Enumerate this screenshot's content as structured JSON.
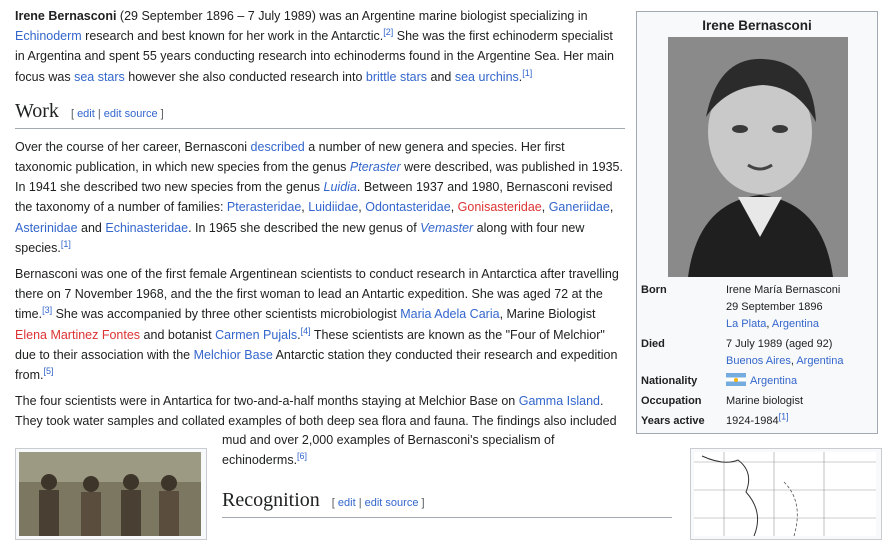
{
  "intro": {
    "name": "Irene Bernasconi",
    "t1": " (29 September 1896 – 7 July 1989) was an Argentine marine biologist specializing in ",
    "link_echinoderm": "Echinoderm",
    "t2": " research and best known for her work in the Antarctic.",
    "ref2": "[2]",
    "t3": " She was the first echinoderm specialist in Argentina and spent 55 years conducting research into echinoderms found in the Argentine Sea. Her main focus was ",
    "link_seastars": "sea stars",
    "t4": " however she also conducted research into ",
    "link_brittlestars": "brittle stars",
    "t5": " and ",
    "link_urchins": "sea urchins",
    "t6": ".",
    "ref1": "[1]"
  },
  "work": {
    "heading": "Work",
    "edit_open": "[",
    "edit": "edit",
    "sep": " | ",
    "edit_source": "edit source",
    "edit_close": "]",
    "p1": {
      "t1": "Over the course of her career, Bernasconi ",
      "link_described": "described",
      "t2": " a number of new genera and species. Her first taxonomic publication, in which new species from the genus ",
      "link_pteraster": "Pteraster",
      "t3": " were described, was published in 1935. In 1941 she described two new species from the genus ",
      "link_luidia": "Luidia",
      "t4": ". Between 1937 and 1980, Bernasconi revised the taxonomy of a number of families: ",
      "f1": "Pterasteridae",
      "c1": ", ",
      "f2": "Luidiidae",
      "c2": ", ",
      "f3": "Odontasteridae",
      "c3": ", ",
      "f4": "Gonisasteridae",
      "c4": ", ",
      "f5": "Ganeriidae",
      "c5": ", ",
      "f6": "Asterinidae",
      "and": " and ",
      "f7": "Echinasteridae",
      "t5": ". In 1965 she described the new genus of ",
      "link_vemaster": "Vemaster",
      "t6": " along with four new species.",
      "ref1": "[1]"
    },
    "p2": {
      "t1": "Bernasconi was one of the first female Argentinean scientists to conduct research in Antarctica after travelling there on 7 November 1968, and the the first woman to lead an Antartic expedition. She was aged 72 at the time.",
      "ref3": "[3]",
      "t2": " She was accompanied by three other scientists microbiologist ",
      "link_caria": "Maria Adela Caria",
      "t3": ", Marine Biologist ",
      "link_fontes": "Elena Martinez Fontes",
      "t4": " and botanist ",
      "link_pujals": "Carmen Pujals",
      "t5": ".",
      "ref4": "[4]",
      "t6": " These scientists are known as the \"Four of Melchior\" due to their association with the ",
      "link_melchior": "Melchior Base",
      "t7": " Antarctic station they conducted their research and expedition from.",
      "ref5": "[5]"
    },
    "p3": {
      "t1": "The four scientists were in Antartica for two-and-a-half months staying at Melchior Base on ",
      "link_gamma": "Gamma Island",
      "t2": ". They took water samples and collated examples of both deep sea flora and fauna. The findings also included",
      "t3": "mud and over 2,000 examples of Bernasconi's specialism of echinoderms.",
      "ref6": "[6]"
    }
  },
  "recognition": {
    "heading": "Recognition",
    "edit_open": "[",
    "edit": "edit",
    "sep": " | ",
    "edit_source": "edit source",
    "edit_close": "]"
  },
  "infobox": {
    "title": "Irene Bernasconi",
    "born_label": "Born",
    "born_name": "Irene María Bernasconi",
    "born_date": "29 September 1896",
    "born_place1": "La Plata",
    "born_comma": ", ",
    "born_place2": "Argentina",
    "died_label": "Died",
    "died_date": "7 July 1989 (aged 92)",
    "died_place1": "Buenos Aires",
    "died_comma": ", ",
    "died_place2": "Argentina",
    "nationality_label": "Nationality",
    "nationality": "Argentina",
    "occupation_label": "Occupation",
    "occupation": "Marine biologist",
    "years_label": "Years active",
    "years": "1924-1984",
    "years_ref": "[1]"
  },
  "colors": {
    "link": "#3366cc",
    "redlink": "#dd3333",
    "text": "#202122",
    "infobox_bg": "#f8f9fa"
  },
  "icons": {
    "flag": "argentina-flag-icon"
  }
}
